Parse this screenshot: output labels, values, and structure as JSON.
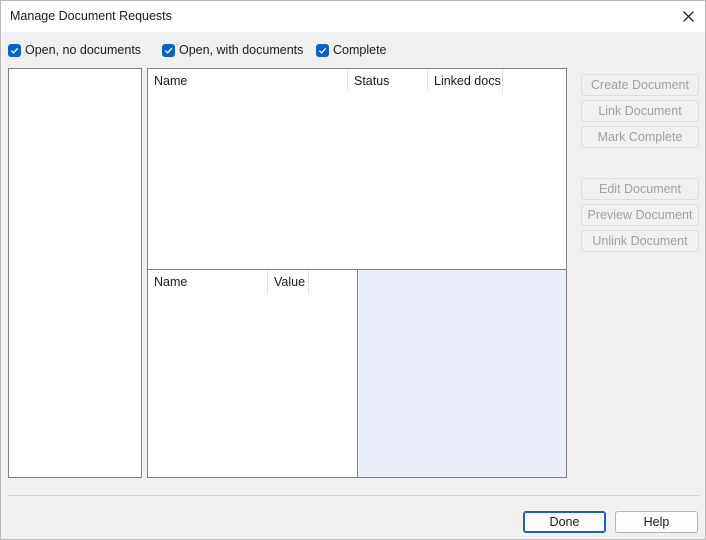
{
  "window": {
    "title": "Manage Document Requests"
  },
  "filters": [
    {
      "label": "Open, no documents",
      "checked": true
    },
    {
      "label": "Open, with documents",
      "checked": true
    },
    {
      "label": "Complete",
      "checked": true
    }
  ],
  "requests_table": {
    "columns": [
      "Name",
      "Status",
      "Linked docs"
    ],
    "rows": []
  },
  "fields_table": {
    "columns": [
      "Name",
      "Value"
    ],
    "rows": []
  },
  "actions": {
    "create_document": "Create Document",
    "link_document": "Link Document",
    "mark_complete": "Mark Complete",
    "edit_document": "Edit Document",
    "preview_document": "Preview Document",
    "unlink_document": "Unlink Document"
  },
  "footer": {
    "done_label": "Done",
    "help_label": "Help"
  },
  "colors": {
    "checkbox_accent": "#0f62c4",
    "preview_background": "#eaeff9",
    "disabled_text": "#a0a0a0"
  }
}
